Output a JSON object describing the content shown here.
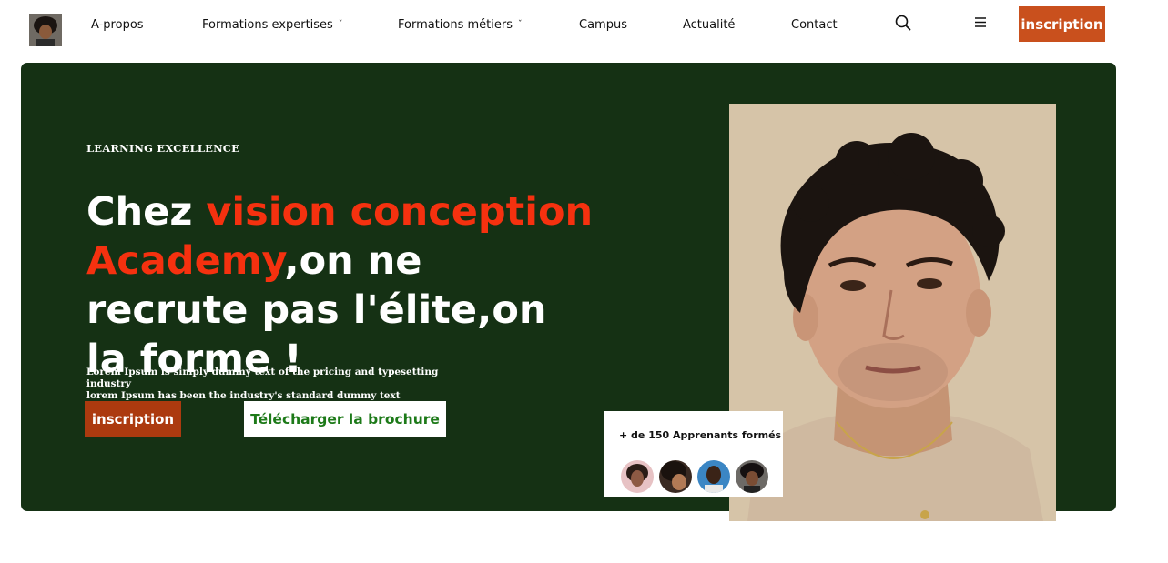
{
  "nav": {
    "items": [
      {
        "label": "A-propos",
        "has_dropdown": false
      },
      {
        "label": "Formations expertises",
        "has_dropdown": true
      },
      {
        "label": "Formations métiers",
        "has_dropdown": true
      },
      {
        "label": "Campus",
        "has_dropdown": false
      },
      {
        "label": "Actualité",
        "has_dropdown": false
      },
      {
        "label": "Contact",
        "has_dropdown": false
      }
    ],
    "dropdown_icon": "chevron-down-icon",
    "search_icon": "search-icon",
    "menu_icon": "hamburger-menu-icon",
    "cta_label": "inscription",
    "logo_icon": "avatar-logo"
  },
  "hero": {
    "eyebrow": "LEARNING EXCELLENCE",
    "headline_part1": "Chez ",
    "headline_accent": "vision conception Academy",
    "headline_part2": ",on ne recrute pas l'élite,on la forme !",
    "description_line1": "Lorem Ipsum is simply dummy text of the pricing and typesetting industry",
    "description_line2": "lorem Ipsum has been the industry's standard dummy text",
    "primary_button": "inscription",
    "secondary_button": "Télécharger la brochure"
  },
  "stats": {
    "text": "+ de 150 Apprenants formés",
    "avatars": [
      "avatar-1",
      "avatar-2",
      "avatar-3",
      "avatar-4"
    ]
  },
  "colors": {
    "hero_bg": "#153114",
    "accent_text": "#f5310f",
    "cta_nav": "#c9501d",
    "cta_hero": "#ac3a0f",
    "secondary_text": "#1d7a19"
  }
}
